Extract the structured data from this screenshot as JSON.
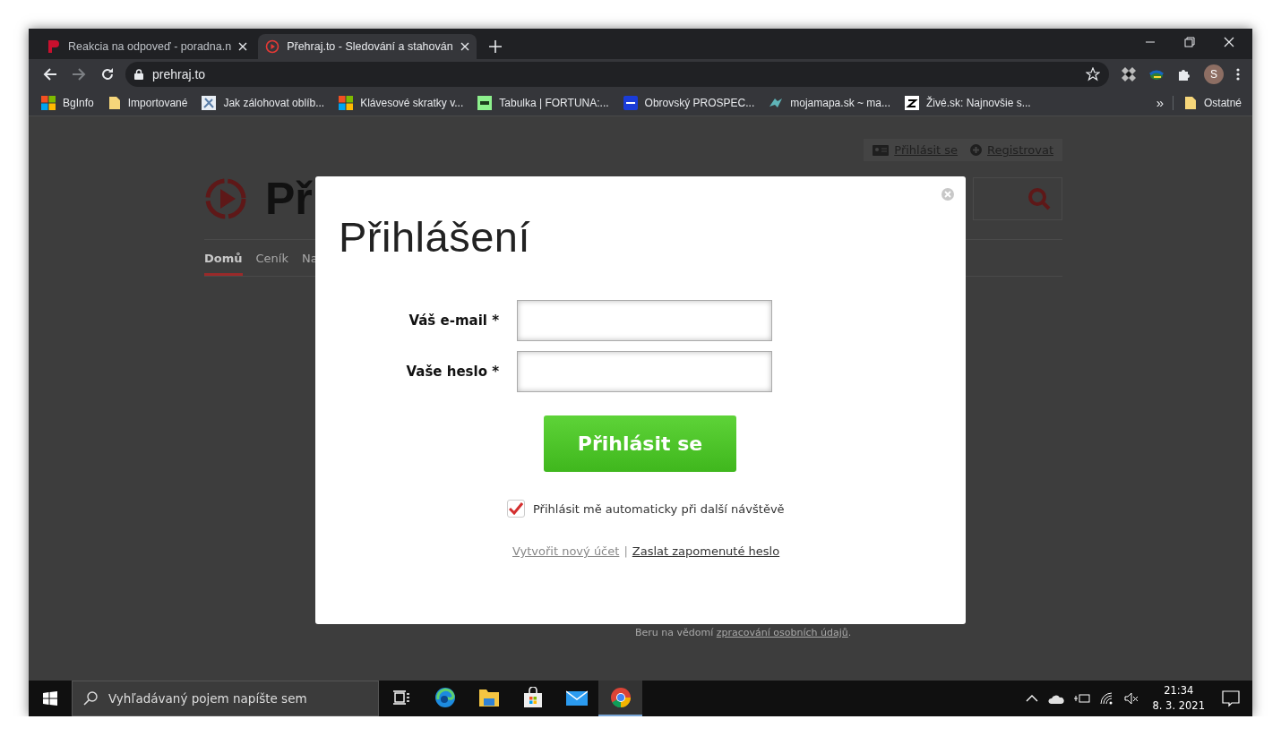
{
  "browser": {
    "tabs": [
      {
        "title": "Reakcia na odpoveď - poradna.n",
        "selected": false,
        "kind": "pnet"
      },
      {
        "title": "Přehraj.to - Sledování a stahován",
        "selected": true,
        "kind": "play"
      }
    ],
    "address": "prehraj.to",
    "bookmarks": [
      {
        "label": "BgInfo",
        "kind": "windows"
      },
      {
        "label": "Importované",
        "kind": "folder"
      },
      {
        "label": "Jak zálohovat oblíb...",
        "kind": "tools"
      },
      {
        "label": "Klávesové skratky v...",
        "kind": "windows"
      },
      {
        "label": "Tabulka | FORTUNA:...",
        "kind": "fortuna"
      },
      {
        "label": "Obrovský PROSPEC...",
        "kind": "square"
      },
      {
        "label": "mojamapa.sk ~ ma...",
        "kind": "map"
      },
      {
        "label": "Živé.sk: Najnovšie s...",
        "kind": "z"
      }
    ],
    "overflow": "»",
    "other_bookmarks": "Ostatné",
    "profile_initial": "S"
  },
  "page": {
    "top_links": [
      "Přihlásit se",
      "Registrovat"
    ],
    "logo_text": "Př",
    "nav": [
      {
        "label": "Domů",
        "selected": true
      },
      {
        "label": "Ceník",
        "selected": false
      },
      {
        "label": "Na",
        "selected": false
      }
    ],
    "consent": {
      "before": "Beru na vědomí ",
      "link": "zpracování osobních údajů",
      "after": "."
    }
  },
  "dialog": {
    "title": "Přihlášení",
    "fields": [
      {
        "label": "Váš e-mail *"
      },
      {
        "label": "Vaše heslo *"
      }
    ],
    "submit": "Přihlásit se",
    "remember": {
      "label": "Přihlásit mě automaticky při další návštěvě",
      "checked": true
    },
    "links": [
      {
        "label": "Vytvořit nový účet",
        "visited": true
      },
      {
        "label": "Zaslat zapomenuté heslo",
        "visited": false
      }
    ],
    "separator": "|"
  },
  "taskbar": {
    "search_placeholder": "Vyhľadávaný pojem napíšte sem",
    "apps": [
      {
        "kind": "taskview",
        "selected": false
      },
      {
        "kind": "edge",
        "selected": false
      },
      {
        "kind": "explorer",
        "selected": false
      },
      {
        "kind": "store",
        "selected": false
      },
      {
        "kind": "mail",
        "selected": false
      },
      {
        "kind": "chrome",
        "selected": true
      }
    ],
    "time": "21:34",
    "date": "8. 3. 2021"
  }
}
